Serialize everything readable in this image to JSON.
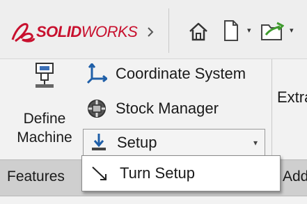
{
  "app": {
    "brand_bold": "SOLID",
    "brand_light": "WORKS"
  },
  "ribbon": {
    "define_machine": "Define\nMachine",
    "coordinate_system": "Coordinate System",
    "stock_manager": "Stock Manager",
    "setup": "Setup",
    "extract": "Extrac"
  },
  "tabs": {
    "features": "Features",
    "addins": "Add-"
  },
  "dropdown": {
    "turn_setup": "Turn Setup"
  },
  "colors": {
    "brand": "#c8102e",
    "accent": "#1f5fa8"
  },
  "icons": [
    "ds-logo-icon",
    "expand-arrow-icon",
    "home-icon",
    "new-document-icon",
    "open-folder-icon",
    "define-machine-icon",
    "coordinate-system-icon",
    "stock-manager-icon",
    "setup-icon",
    "turn-setup-icon"
  ]
}
